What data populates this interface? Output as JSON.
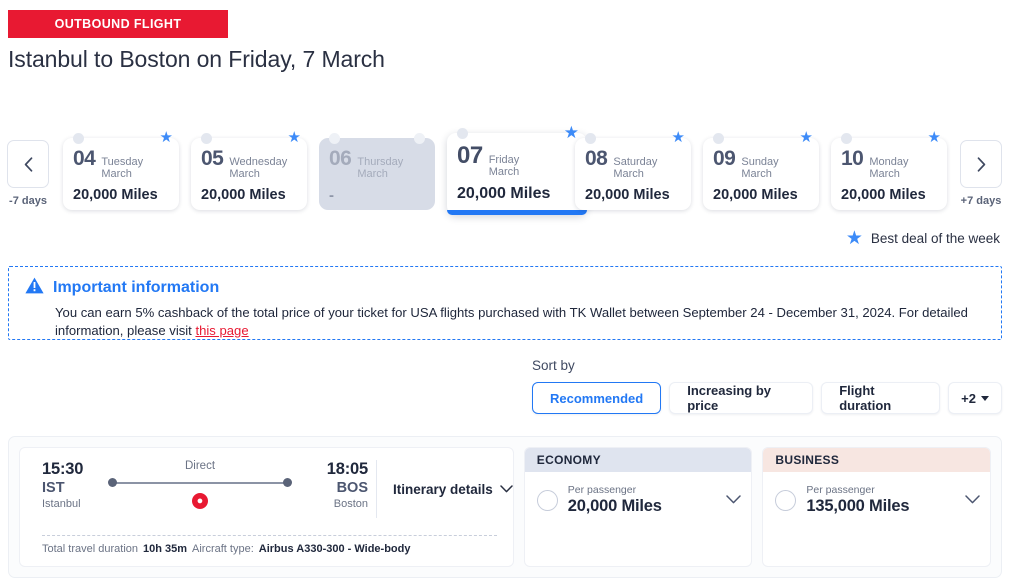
{
  "header": {
    "badge": "OUTBOUND FLIGHT",
    "title": "Istanbul to Boston on Friday, 7 March"
  },
  "date_strip": {
    "prev": {
      "icon": "chevron-left-icon",
      "label": "-7 days"
    },
    "next": {
      "icon": "chevron-right-icon",
      "label": "+7 days"
    },
    "legend": {
      "icon": "star-icon",
      "text": "Best deal of the week"
    },
    "dates": [
      {
        "day": "04",
        "weekday": "Tuesday",
        "month": "March",
        "price": "20,000 Miles",
        "best_deal": true,
        "selected": false,
        "disabled": false
      },
      {
        "day": "05",
        "weekday": "Wednesday",
        "month": "March",
        "price": "20,000 Miles",
        "best_deal": true,
        "selected": false,
        "disabled": false
      },
      {
        "day": "06",
        "weekday": "Thursday",
        "month": "March",
        "price": "-",
        "best_deal": false,
        "selected": false,
        "disabled": true
      },
      {
        "day": "07",
        "weekday": "Friday",
        "month": "March",
        "price": "20,000 Miles",
        "best_deal": true,
        "selected": true,
        "disabled": false
      },
      {
        "day": "08",
        "weekday": "Saturday",
        "month": "March",
        "price": "20,000 Miles",
        "best_deal": true,
        "selected": false,
        "disabled": false
      },
      {
        "day": "09",
        "weekday": "Sunday",
        "month": "March",
        "price": "20,000 Miles",
        "best_deal": true,
        "selected": false,
        "disabled": false
      },
      {
        "day": "10",
        "weekday": "Monday",
        "month": "March",
        "price": "20,000 Miles",
        "best_deal": true,
        "selected": false,
        "disabled": false
      }
    ]
  },
  "info_box": {
    "icon": "warning-triangle-icon",
    "title": "Important information",
    "text_before": "You can earn 5% cashback of the total price of your ticket for USA flights purchased with TK Wallet between September 24 - December 31, 2024. For detailed information, please visit ",
    "link_text": "this page"
  },
  "sort": {
    "label": "Sort by",
    "options": [
      {
        "label": "Recommended",
        "active": true
      },
      {
        "label": "Increasing by price",
        "active": false
      },
      {
        "label": "Flight duration",
        "active": false
      }
    ],
    "more_label": "+2"
  },
  "flight": {
    "departure": {
      "time": "15:30",
      "code": "IST",
      "city": "Istanbul"
    },
    "arrival": {
      "time": "18:05",
      "code": "BOS",
      "city": "Boston"
    },
    "stops_label": "Direct",
    "carrier_icon": "turkish-airlines-logo",
    "itinerary_label": "Itinerary details",
    "footer": {
      "duration_label": "Total travel duration",
      "duration_value": "10h 35m",
      "aircraft_label": "Aircraft type:",
      "aircraft_value": "Airbus A330-300 - Wide-body"
    },
    "cabins": [
      {
        "name": "ECONOMY",
        "per_passenger": "Per passenger",
        "price": "20,000 Miles",
        "accent": "#dfe4ef"
      },
      {
        "name": "BUSINESS",
        "per_passenger": "Per passenger",
        "price": "135,000 Miles",
        "accent": "#f7e6e1"
      }
    ]
  },
  "colors": {
    "brand_red": "#e81932",
    "accent_blue": "#2278f4",
    "star_blue": "#3d8bf8"
  }
}
